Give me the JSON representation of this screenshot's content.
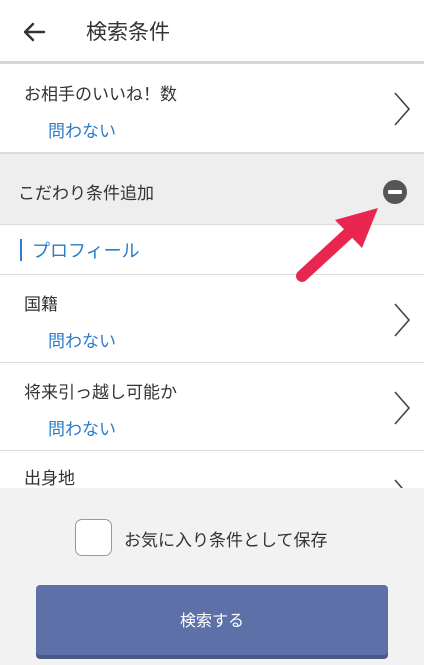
{
  "header": {
    "title": "検索条件",
    "back_icon": "arrow-left-icon"
  },
  "rows": {
    "likes": {
      "label": "お相手のいいね！数",
      "value": "問わない"
    },
    "section": {
      "label": "こだわり条件追加"
    },
    "profile": {
      "label": "プロフィール"
    },
    "nationality": {
      "label": "国籍",
      "value": "問わない"
    },
    "relocation": {
      "label": "将来引っ越し可能か",
      "value": "問わない"
    },
    "hometown": {
      "label": "出身地"
    }
  },
  "footer": {
    "save_checkbox_label": "お気に入り条件として保存",
    "search_button_label": "検索する"
  },
  "colors": {
    "accent": "#2b7cc9",
    "button": "#5d71a8",
    "annotation_arrow": "#e8264f"
  }
}
